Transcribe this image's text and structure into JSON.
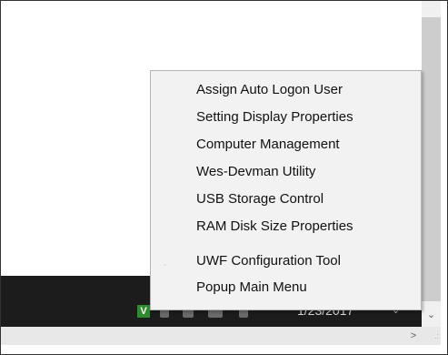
{
  "menu": {
    "items": [
      {
        "label": "Assign Auto Logon User"
      },
      {
        "label": "Setting Display Properties"
      },
      {
        "label": "Computer Management"
      },
      {
        "label": "Wes-Devman Utility"
      },
      {
        "label": "USB Storage Control"
      },
      {
        "label": "RAM Disk Size Properties"
      },
      {
        "label": "UWF Configuration Tool"
      },
      {
        "label": "Popup Main Menu"
      }
    ]
  },
  "taskbar": {
    "date": "1/23/2017",
    "tray_icon_letter": "V",
    "tray_icon_color": "#2e8b2e",
    "background_color": "#1c1c1c"
  },
  "scrollbars": {
    "down_arrow_glyph": "▼",
    "right_arrow_glyph": ">"
  }
}
